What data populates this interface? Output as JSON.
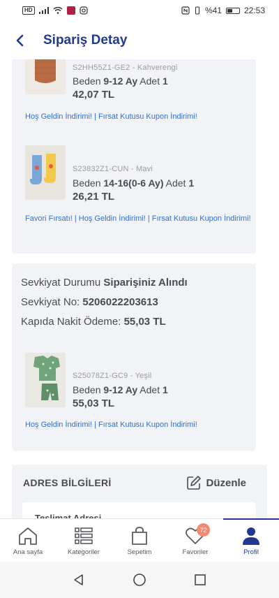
{
  "status": {
    "hd": "HD",
    "battery": "%41",
    "time": "22:53"
  },
  "header": {
    "title": "Sipariş Detay"
  },
  "order1": {
    "items": [
      {
        "sku": "S2HH55Z1-GE2 - Kahverengi",
        "size_label": "Beden",
        "size": "9-12 Ay",
        "qty_label": "Adet",
        "qty": "1",
        "price": "42,07 TL",
        "promo": "Hoş Geldin İndirimi! | Fırsat Kutusu Kupon İndirimi!"
      },
      {
        "sku": "S23832Z1-CUN - Mavi",
        "size_label": "Beden",
        "size": "14-16(0-6 Ay)",
        "qty_label": "Adet",
        "qty": "1",
        "price": "26,21 TL",
        "promo": "Favori Fırsatı! | Hoş Geldin İndirimi! | Fırsat Kutusu Kupon İndirimi!"
      }
    ]
  },
  "shipment": {
    "status_label": "Sevkiyat Durumu",
    "status_value": "Siparişiniz Alındı",
    "number_label": "Sevkiyat No:",
    "number_value": "5206022203613",
    "payment_label": "Kapıda Nakit Ödeme:",
    "payment_value": "55,03 TL",
    "item": {
      "sku": "S25078Z1-GC9 - Yeşil",
      "size_label": "Beden",
      "size": "9-12 Ay",
      "qty_label": "Adet",
      "qty": "1",
      "price": "55,03 TL",
      "promo": "Hoş Geldin İndirimi! | Fırsat Kutusu Kupon İndirimi!"
    }
  },
  "address": {
    "title": "ADRES BİLGİLERİ",
    "edit_label": "Düzenle",
    "delivery_title": "Teslimat Adresi"
  },
  "bottom_nav": {
    "items": [
      {
        "label": "Ana sayfa",
        "icon": "home-icon"
      },
      {
        "label": "Kategoriler",
        "icon": "categories-icon"
      },
      {
        "label": "Sepetim",
        "icon": "bag-icon"
      },
      {
        "label": "Favoriler",
        "icon": "heart-icon",
        "badge": "72"
      },
      {
        "label": "Profil",
        "icon": "user-icon",
        "active": true
      }
    ]
  },
  "colors": {
    "brand_blue": "#213a8f",
    "promo_blue": "#2f6fd6",
    "badge": "#f28a72"
  }
}
